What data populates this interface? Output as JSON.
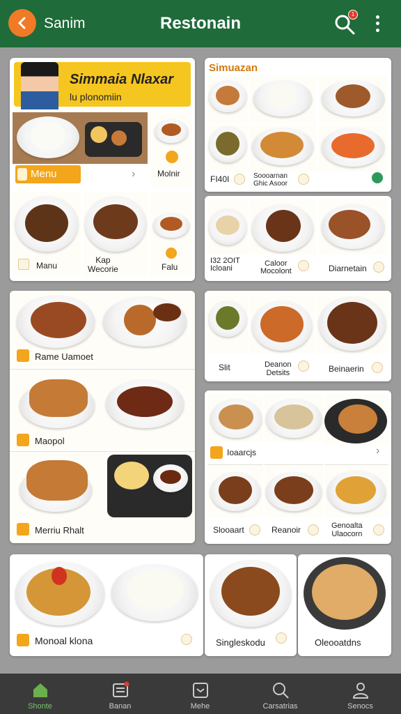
{
  "header": {
    "left_title": "Sanim",
    "app_title": "Restonain",
    "notification_count": "1"
  },
  "featured": {
    "banner_title": "Simmaia Nlaxar",
    "banner_subtitle": "lu plonomiin",
    "menu_label": "Menu",
    "side_label": "Molnir",
    "items": [
      {
        "label": "Manu"
      },
      {
        "label": "Kap\nWecorie"
      },
      {
        "label": "Falu"
      }
    ]
  },
  "right_top": {
    "title": "Simuazan",
    "items": [
      {
        "label": "FI40I"
      },
      {
        "label": "Soooarnan\nGhic Asoor"
      },
      {
        "label": ""
      }
    ]
  },
  "right_mid": {
    "items": [
      {
        "label": "I32 2OIT\nIcloani"
      },
      {
        "label": "Caloor\nMocolont"
      },
      {
        "label": "Diarnetain"
      }
    ]
  },
  "left_list": {
    "items": [
      {
        "label": "Rame Uamoet"
      },
      {
        "label": "Maopol"
      },
      {
        "label": "Merriu Rhalt"
      }
    ]
  },
  "right_row3": {
    "items": [
      {
        "label": "Slit"
      },
      {
        "label": "Deanon\nDetsits"
      },
      {
        "label": "Beinaerin"
      }
    ]
  },
  "right_row4": {
    "section_label": "Ioaarcjs",
    "items": [
      {
        "label": "Slooaart"
      },
      {
        "label": "Reanoir"
      },
      {
        "label": "Genoalta\nUlaocorn"
      }
    ]
  },
  "bottom_row": {
    "items": [
      {
        "label": "Monoal klona"
      },
      {
        "label": "Singleskodu"
      },
      {
        "label": "Oleooatdns"
      }
    ]
  },
  "nav": {
    "items": [
      {
        "label": "Shonte",
        "icon": "home-icon"
      },
      {
        "label": "Banan",
        "icon": "receipt-icon"
      },
      {
        "label": "Mehe",
        "icon": "chat-icon"
      },
      {
        "label": "Carsatrias",
        "icon": "search-icon"
      },
      {
        "label": "Senocs",
        "icon": "profile-icon"
      }
    ]
  },
  "colors": {
    "header_green": "#1f6b3a",
    "accent_orange": "#f07a25",
    "tag_yellow": "#f3a51b",
    "nav_active": "#7cc36a"
  }
}
